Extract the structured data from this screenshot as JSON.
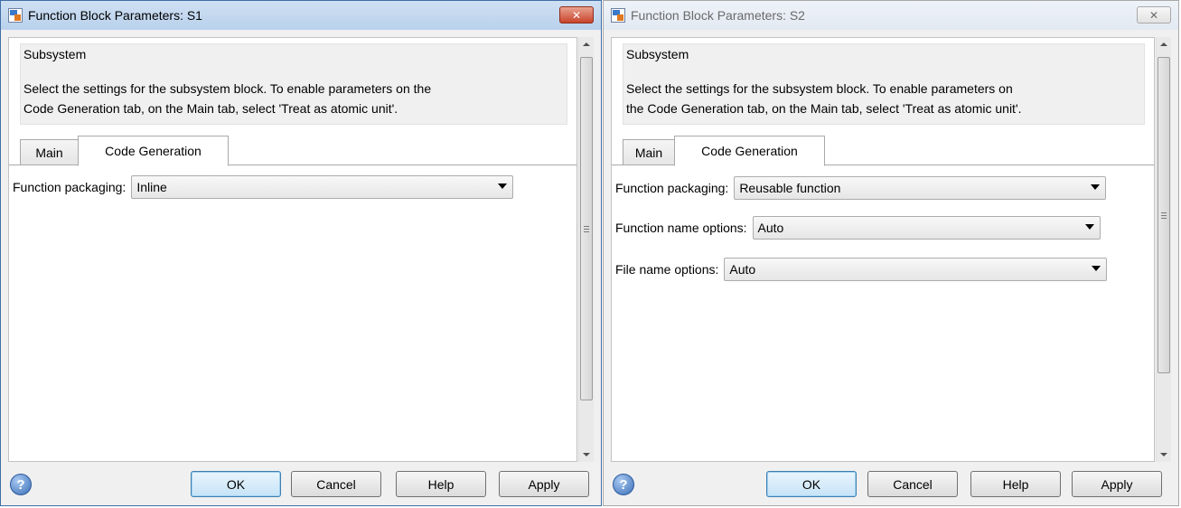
{
  "dialogs": [
    {
      "title": "Function Block Parameters: S1",
      "close_symbol": "✕",
      "section_title": "Subsystem",
      "description_lines": [
        "Select the settings for the subsystem block. To enable parameters on the",
        "Code Generation tab, on the Main tab, select 'Treat as atomic unit'."
      ],
      "tabs": [
        "Main",
        "Code Generation"
      ],
      "active_tab": "Code Generation",
      "parameters": [
        {
          "label": "Function packaging:",
          "value": "Inline"
        }
      ],
      "buttons": {
        "ok": "OK",
        "cancel": "Cancel",
        "help": "Help",
        "apply": "Apply"
      },
      "help_icon_glyph": "?",
      "focused": true
    },
    {
      "title": "Function Block Parameters: S2",
      "close_symbol": "✕",
      "section_title": "Subsystem",
      "description_lines": [
        "Select the settings for the subsystem block. To enable parameters on",
        "the Code Generation tab, on the Main tab, select 'Treat as atomic unit'."
      ],
      "tabs": [
        "Main",
        "Code Generation"
      ],
      "active_tab": "Code Generation",
      "parameters": [
        {
          "label": "Function packaging:",
          "value": "Reusable function"
        },
        {
          "label": "Function name options:",
          "value": "Auto"
        },
        {
          "label": "File name options:",
          "value": "Auto"
        }
      ],
      "buttons": {
        "ok": "OK",
        "cancel": "Cancel",
        "help": "Help",
        "apply": "Apply"
      },
      "help_icon_glyph": "?",
      "focused": false
    }
  ],
  "colors": {
    "active_titlebar": "#b9d1ec",
    "inactive_titlebar": "#e3e9f1",
    "close_active": "#c8442b",
    "default_button_border": "#3c7fb1"
  }
}
